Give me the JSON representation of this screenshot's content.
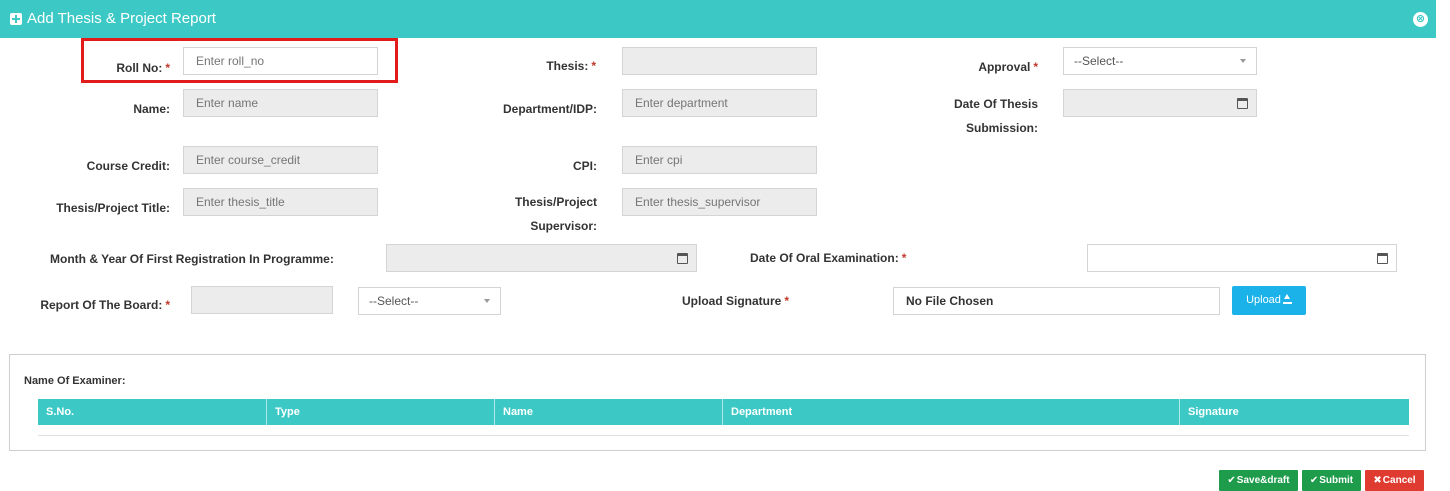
{
  "header": {
    "title": "Add Thesis & Project Report",
    "close_glyph": "⊗"
  },
  "form": {
    "roll_no": {
      "label": "Roll No:",
      "placeholder": "Enter roll_no",
      "required": "*"
    },
    "thesis": {
      "label": "Thesis:",
      "value": "",
      "required": "*"
    },
    "approval": {
      "label": "Approval",
      "value": "--Select--",
      "required": "*"
    },
    "name": {
      "label": "Name:",
      "placeholder": "Enter name"
    },
    "department": {
      "label": "Department/IDP:",
      "placeholder": "Enter department"
    },
    "date_of_submission": {
      "label": "Date Of Thesis Submission:",
      "value": ""
    },
    "course_credit": {
      "label": "Course Credit:",
      "placeholder": "Enter course_credit"
    },
    "cpi": {
      "label": "CPI:",
      "placeholder": "Enter cpi"
    },
    "thesis_title": {
      "label": "Thesis/Project Title:",
      "placeholder": "Enter thesis_title"
    },
    "thesis_supervisor": {
      "label": "Thesis/Project Supervisor:",
      "placeholder": "Enter thesis_supervisor"
    },
    "first_registration": {
      "label": "Month & Year Of First Registration In Programme:",
      "value": ""
    },
    "oral_examination": {
      "label": "Date Of Oral Examination:",
      "value": "",
      "required": "*"
    },
    "report_of_board": {
      "label": "Report Of The Board:",
      "value": "",
      "select_value": "--Select--",
      "required": "*"
    },
    "upload_signature": {
      "label": "Upload Signature",
      "file_text": "No File Chosen",
      "button_label": "Upload",
      "required": "*"
    }
  },
  "examiners": {
    "title": "Name Of Examiner:",
    "columns": [
      "S.No.",
      "Type",
      "Name",
      "Department",
      "Signature"
    ]
  },
  "actions": {
    "save_draft": "Save&draft",
    "submit": "Submit",
    "cancel": "Cancel",
    "check_glyph": "✔",
    "cancel_glyph": "✖"
  },
  "colors": {
    "header": "#3cc9c6",
    "required": "#c0392b",
    "highlight": "#e21b1b",
    "upload_button": "#1ab2e8",
    "green_button": "#1e9c4b",
    "red_button": "#e03b30"
  }
}
